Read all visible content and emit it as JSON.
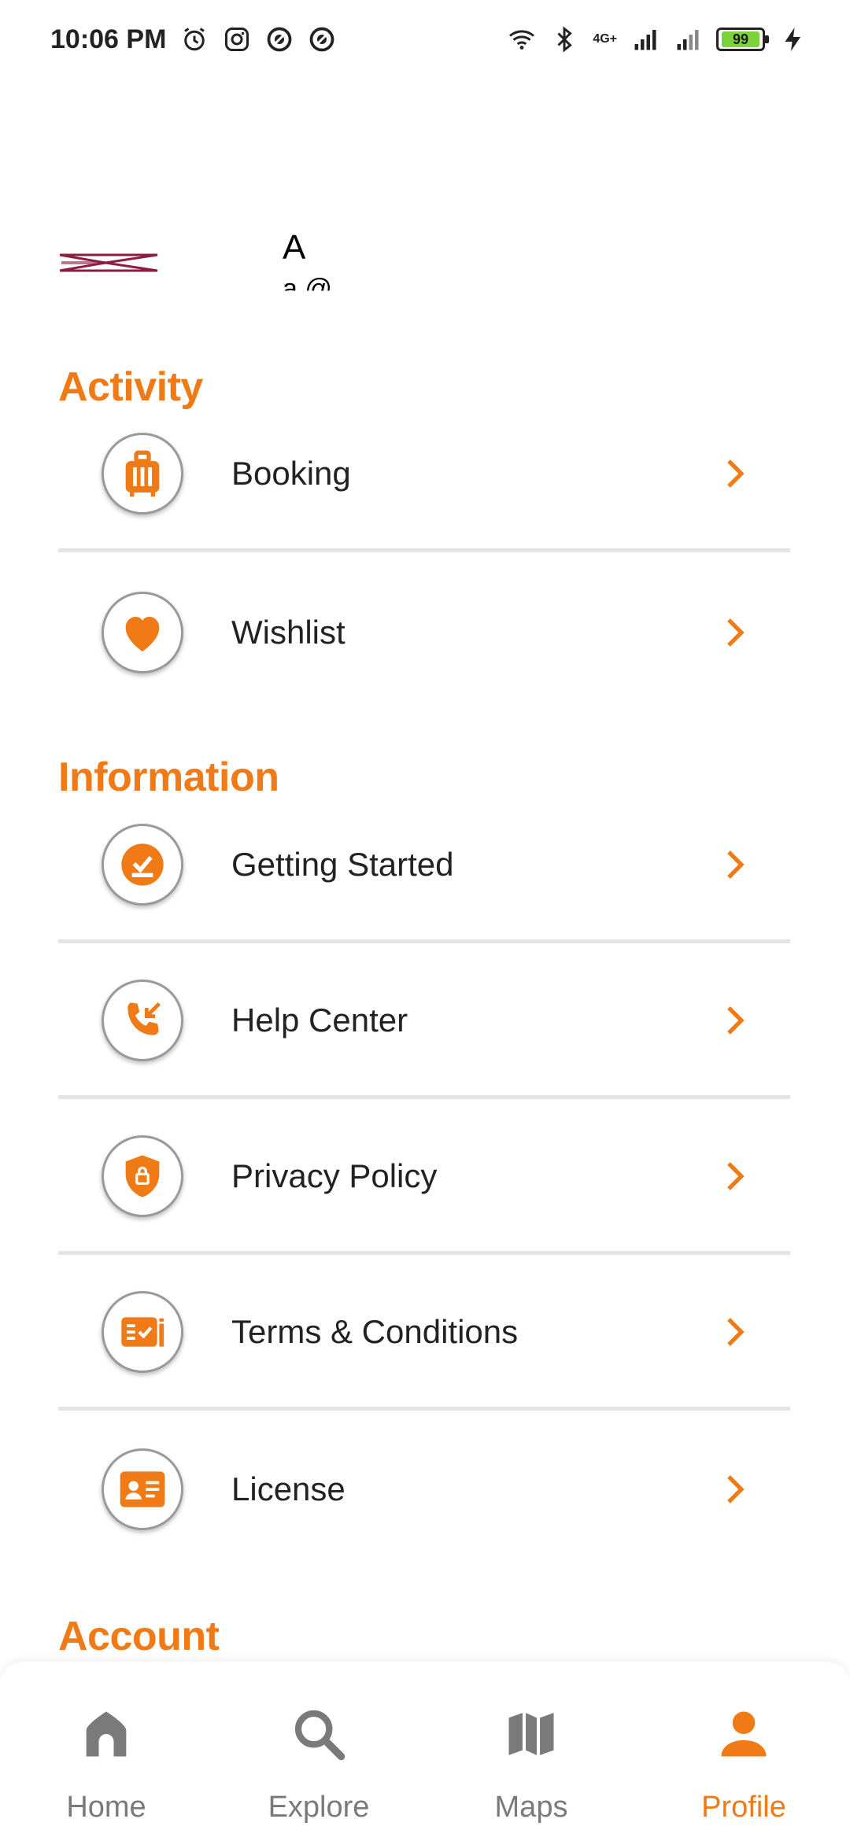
{
  "status_bar": {
    "time": "10:06 PM",
    "network_label": "4G+",
    "battery_level": "99",
    "left_icons": [
      "alarm-icon",
      "instagram-icon",
      "app-icon",
      "app-icon"
    ],
    "right_icons": [
      "wifi-icon",
      "bluetooth-icon",
      "signal-icon",
      "signal-icon",
      "battery-icon",
      "charging-icon"
    ]
  },
  "profile": {
    "name": "A",
    "email": "a @"
  },
  "colors": {
    "accent": "#f07a16",
    "divider": "#e4e4e4",
    "inactive": "#7a7a7a"
  },
  "sections": {
    "activity": {
      "title": "Activity",
      "items": [
        {
          "label": "Booking",
          "icon": "luggage-icon"
        },
        {
          "label": "Wishlist",
          "icon": "heart-icon"
        }
      ]
    },
    "information": {
      "title": "Information",
      "items": [
        {
          "label": "Getting Started",
          "icon": "check-download-icon"
        },
        {
          "label": "Help Center",
          "icon": "phone-callback-icon"
        },
        {
          "label": "Privacy Policy",
          "icon": "shield-lock-icon"
        },
        {
          "label": "Terms & Conditions",
          "icon": "document-check-icon"
        },
        {
          "label": "License",
          "icon": "id-card-icon"
        }
      ]
    },
    "account": {
      "title": "Account"
    }
  },
  "bottom_nav": {
    "items": [
      {
        "label": "Home",
        "icon": "home-icon",
        "active": false
      },
      {
        "label": "Explore",
        "icon": "search-icon",
        "active": false
      },
      {
        "label": "Maps",
        "icon": "map-icon",
        "active": false
      },
      {
        "label": "Profile",
        "icon": "person-icon",
        "active": true
      }
    ]
  }
}
